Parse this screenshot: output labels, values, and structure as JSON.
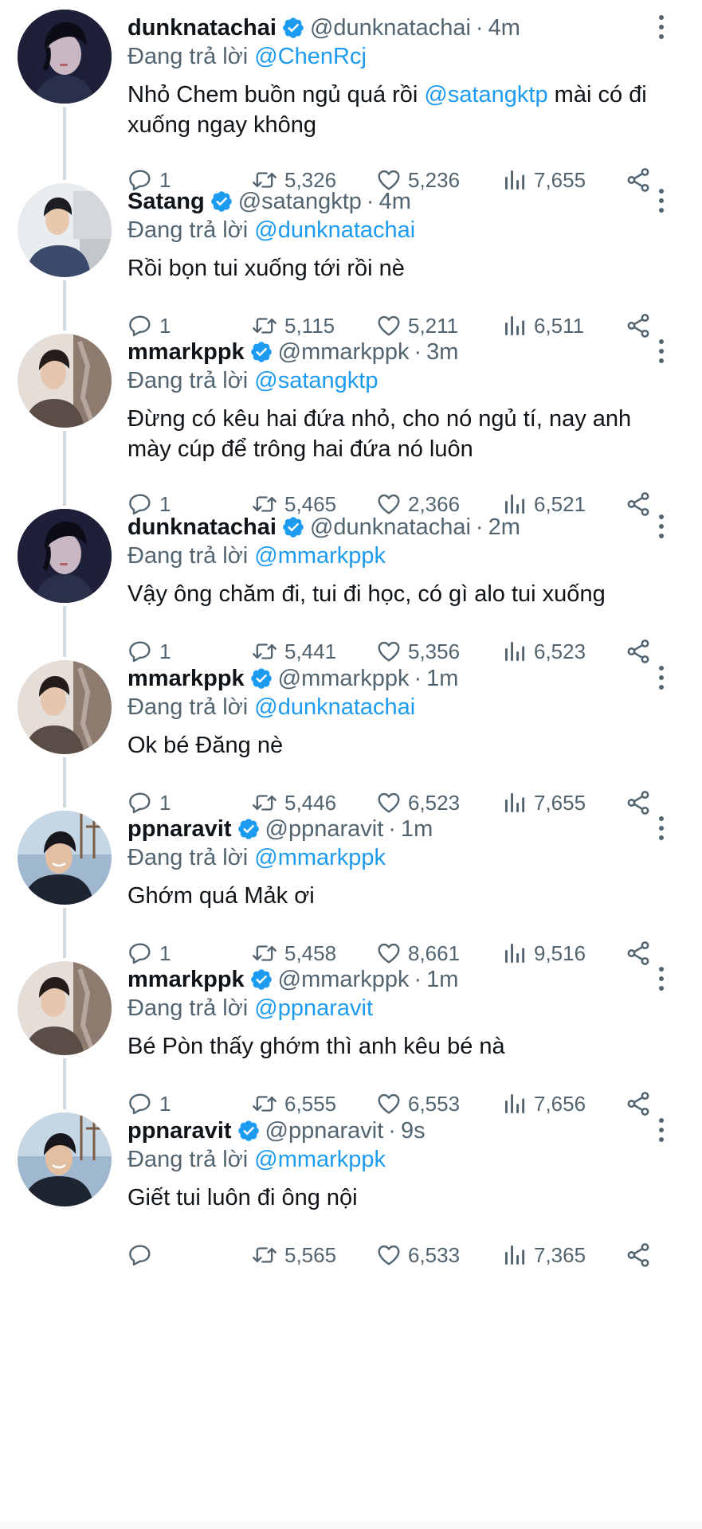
{
  "labels": {
    "reply_prefix": "Đang trả lời",
    "separator": "·"
  },
  "colors": {
    "accent": "#1d9bf0",
    "secondary_text": "#536471",
    "thread_line": "#cfd9de"
  },
  "tweets": [
    {
      "author": "dunknatachai",
      "handle": "@dunknatachai",
      "time": "4m",
      "verified": true,
      "replying_to": "@ChenRcj",
      "text_segments": [
        {
          "t": "Nhỏ Chem buồn ngủ quá rồi ",
          "link": false
        },
        {
          "t": "@satangktp",
          "link": true
        },
        {
          "t": " mài có đi xuống ngay không",
          "link": false
        }
      ],
      "stats": {
        "replies": "1",
        "retweets": "5,326",
        "likes": "5,236",
        "views": "7,655"
      },
      "avatar": "dunk"
    },
    {
      "author": "Satang",
      "handle": "@satangktp",
      "time": "4m",
      "verified": true,
      "replying_to": "@dunknatachai",
      "text_segments": [
        {
          "t": "Rồi bọn tui xuống tới rồi nè",
          "link": false
        }
      ],
      "stats": {
        "replies": "1",
        "retweets": "5,115",
        "likes": "5,211",
        "views": "6,511"
      },
      "avatar": "satang"
    },
    {
      "author": "mmarkppk",
      "handle": "@mmarkppk",
      "time": "3m",
      "verified": true,
      "replying_to": "@satangktp",
      "text_segments": [
        {
          "t": "Đừng có kêu hai đứa nhỏ, cho nó ngủ tí, nay anh mày cúp để trông hai đứa nó luôn",
          "link": false
        }
      ],
      "stats": {
        "replies": "1",
        "retweets": "5,465",
        "likes": "2,366",
        "views": "6,521"
      },
      "avatar": "mark"
    },
    {
      "author": "dunknatachai",
      "handle": "@dunknatachai",
      "time": "2m",
      "verified": true,
      "replying_to": "@mmarkppk",
      "text_segments": [
        {
          "t": "Vậy ông chăm đi, tui đi học, có gì alo tui xuống",
          "link": false
        }
      ],
      "stats": {
        "replies": "1",
        "retweets": "5,441",
        "likes": "5,356",
        "views": "6,523"
      },
      "avatar": "dunk"
    },
    {
      "author": "mmarkppk",
      "handle": "@mmarkppk",
      "time": "1m",
      "verified": true,
      "replying_to": "@dunknatachai",
      "text_segments": [
        {
          "t": "Ok bé Đăng nè",
          "link": false
        }
      ],
      "stats": {
        "replies": "1",
        "retweets": "5,446",
        "likes": "6,523",
        "views": "7,655"
      },
      "avatar": "mark"
    },
    {
      "author": "ppnaravit",
      "handle": "@ppnaravit",
      "time": "1m",
      "verified": true,
      "replying_to": "@mmarkppk",
      "text_segments": [
        {
          "t": "Ghớm quá Mảk ơi",
          "link": false
        }
      ],
      "stats": {
        "replies": "1",
        "retweets": "5,458",
        "likes": "8,661",
        "views": "9,516"
      },
      "avatar": "pond"
    },
    {
      "author": "mmarkppk",
      "handle": "@mmarkppk",
      "time": "1m",
      "verified": true,
      "replying_to": "@ppnaravit",
      "text_segments": [
        {
          "t": "Bé Pòn thấy ghớm thì anh kêu bé nà",
          "link": false
        }
      ],
      "stats": {
        "replies": "1",
        "retweets": "6,555",
        "likes": "6,553",
        "views": "7,656"
      },
      "avatar": "mark"
    },
    {
      "author": "ppnaravit",
      "handle": "@ppnaravit",
      "time": "9s",
      "verified": true,
      "replying_to": "@mmarkppk",
      "text_segments": [
        {
          "t": "Giết tui luôn đi ông nội",
          "link": false
        }
      ],
      "stats": {
        "replies": "",
        "retweets": "5,565",
        "likes": "6,533",
        "views": "7,365"
      },
      "avatar": "pond"
    }
  ]
}
